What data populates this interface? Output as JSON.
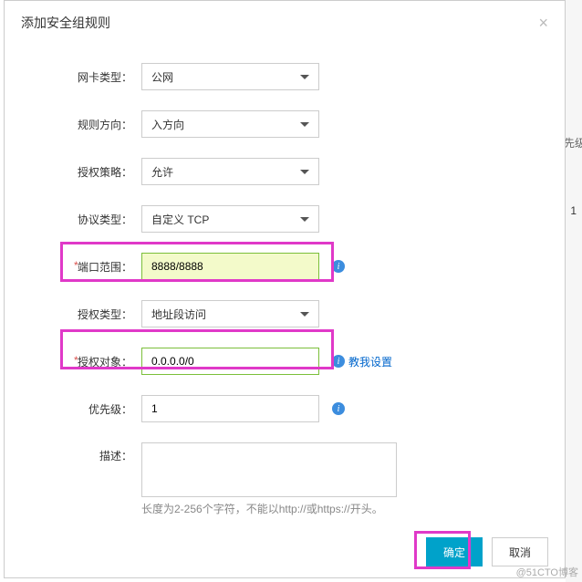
{
  "dialog": {
    "title": "添加安全组规则"
  },
  "form": {
    "nic_type": {
      "label": "网卡类型：",
      "value": "公网"
    },
    "direction": {
      "label": "规则方向：",
      "value": "入方向"
    },
    "auth_policy": {
      "label": "授权策略：",
      "value": "允许"
    },
    "protocol": {
      "label": "协议类型：",
      "value": "自定义 TCP"
    },
    "port_range": {
      "label": "端口范围：",
      "value": "8888/8888"
    },
    "auth_type": {
      "label": "授权类型：",
      "value": "地址段访问"
    },
    "auth_object": {
      "label": "授权对象：",
      "value": "0.0.0.0/0",
      "help": "教我设置"
    },
    "priority": {
      "label": "优先级：",
      "value": "1"
    },
    "description": {
      "label": "描述：",
      "value": "",
      "hint": "长度为2-256个字符，不能以http://或https://开头。"
    }
  },
  "buttons": {
    "confirm": "确定",
    "cancel": "取消"
  },
  "bg": {
    "col1": "优先级",
    "col2": "1"
  },
  "watermark": "@51CTO博客"
}
